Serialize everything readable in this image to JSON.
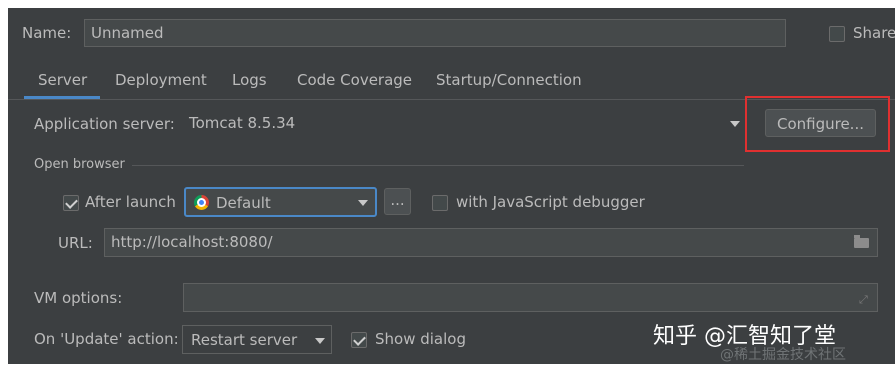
{
  "header": {
    "name_label": "Name:",
    "name_value": "Unnamed",
    "share_label": "Share"
  },
  "tabs": [
    {
      "label": "Server"
    },
    {
      "label": "Deployment"
    },
    {
      "label": "Logs"
    },
    {
      "label": "Code Coverage"
    },
    {
      "label": "Startup/Connection"
    }
  ],
  "server": {
    "app_server_label": "Application server:",
    "app_server_value": "Tomcat 8.5.34",
    "configure_label": "Configure..."
  },
  "open_browser": {
    "section_label": "Open browser",
    "after_launch_label": "After launch",
    "after_launch_checked": true,
    "browser_value": "Default",
    "more_label": "...",
    "js_debugger_label": "with JavaScript debugger",
    "js_debugger_checked": false,
    "url_label": "URL:",
    "url_value": "http://localhost:8080/"
  },
  "vm": {
    "label": "VM options:",
    "value": ""
  },
  "update": {
    "label": "On 'Update' action:",
    "value": "Restart server",
    "show_dialog_label": "Show dialog",
    "show_dialog_checked": true
  },
  "watermark": {
    "main": "知乎 @汇智知了堂",
    "sub": "@稀土掘金技术社区"
  },
  "colors": {
    "panel_bg": "#3c3f41",
    "highlight_box": "#e03030",
    "focus_ring": "#4a88c7"
  }
}
